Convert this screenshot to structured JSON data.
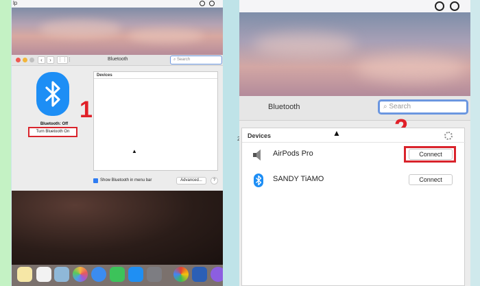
{
  "left_window": {
    "menubar_logo": "lp",
    "title": "Bluetooth",
    "search_placeholder": "Search",
    "nav_back": "‹",
    "nav_forward": "›",
    "grid_label": "⋮⋮⋮",
    "bluetooth_status": "Bluetooth: Off",
    "turn_on_label": "Turn Bluetooth On",
    "devices_header": "Devices",
    "show_in_menu_bar_label": "Show Bluetooth in menu bar",
    "advanced_label": "Advanced...",
    "help_label": "?",
    "step_marker": "1"
  },
  "right_window": {
    "title": "Bluetooth",
    "search_placeholder": "Search",
    "devices_header": "Devices",
    "step_marker": "2",
    "devices": [
      {
        "name": "AirPods Pro",
        "action": "Connect",
        "icon": "speaker-icon"
      },
      {
        "name": "SANDY TiAMO",
        "action": "Connect",
        "icon": "bluetooth-icon"
      }
    ]
  },
  "stray_label": "2",
  "colors": {
    "bluetooth_blue": "#1d8ef5",
    "highlight_red": "#d9232b",
    "search_focus": "#6b96e0"
  }
}
